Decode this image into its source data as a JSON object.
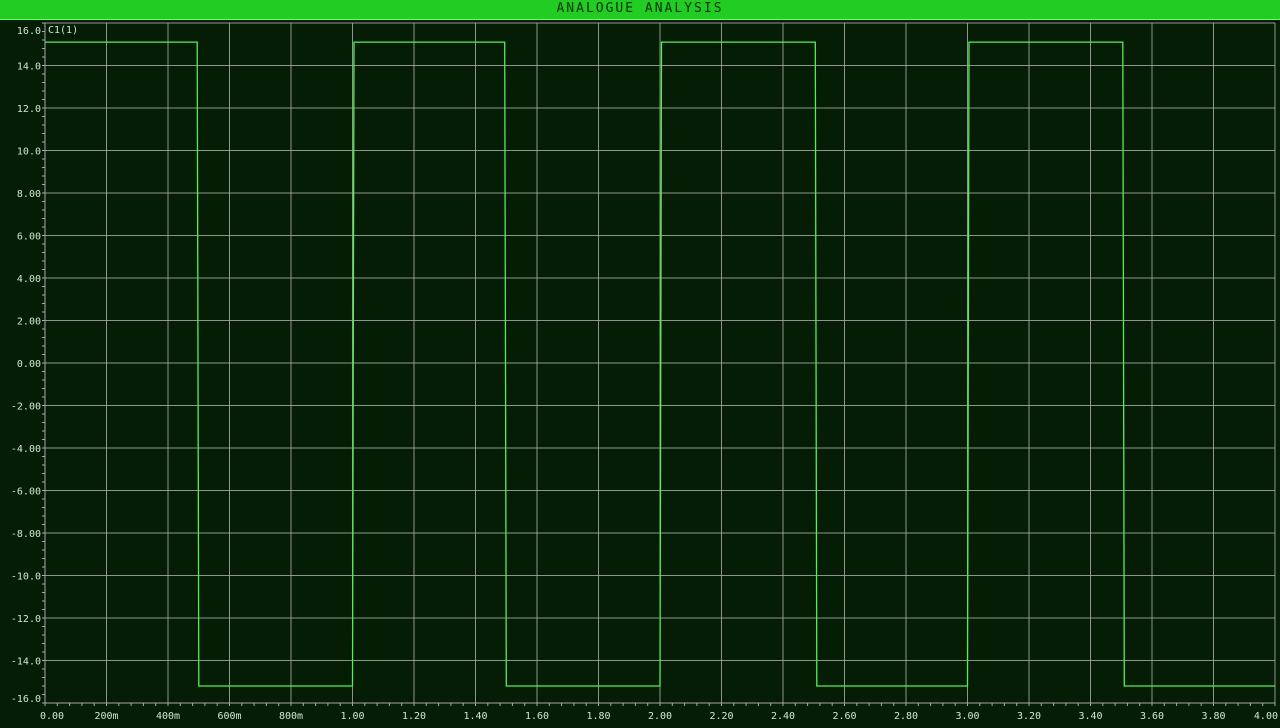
{
  "window": {
    "title": "ANALOGUE ANALYSIS"
  },
  "colors": {
    "background": "#041d04",
    "grid": "#a8a8a8",
    "trace": "#55ee55",
    "title_bar": "#22cc22",
    "tick_text": "#cfe8cf"
  },
  "chart_data": {
    "type": "line",
    "title": "ANALOGUE ANALYSIS",
    "xlabel": "",
    "ylabel": "",
    "xlim": [
      0,
      4.0
    ],
    "ylim": [
      -16.0,
      16.0
    ],
    "grid": true,
    "x_ticks": [
      0,
      0.2,
      0.4,
      0.6,
      0.8,
      1.0,
      1.2,
      1.4,
      1.6,
      1.8,
      2.0,
      2.2,
      2.4,
      2.6,
      2.8,
      3.0,
      3.2,
      3.4,
      3.6,
      3.8,
      4.0
    ],
    "x_tick_labels": [
      "0.00",
      "200m",
      "400m",
      "600m",
      "800m",
      "1.00",
      "1.20",
      "1.40",
      "1.60",
      "1.80",
      "2.00",
      "2.20",
      "2.40",
      "2.60",
      "2.80",
      "3.00",
      "3.20",
      "3.40",
      "3.60",
      "3.80",
      "4.00"
    ],
    "y_ticks": [
      16,
      14,
      12,
      10,
      8,
      6,
      4,
      2,
      0,
      -2,
      -4,
      -6,
      -8,
      -10,
      -12,
      -14,
      -16
    ],
    "y_tick_labels": [
      "16.0",
      "14.0",
      "12.0",
      "10.0",
      "8.00",
      "6.00",
      "4.00",
      "2.00",
      "0.00",
      "-2.00",
      "-4.00",
      "-6.00",
      "-8.00",
      "-10.0",
      "-12.0",
      "-14.0",
      "-16.0"
    ],
    "series": [
      {
        "name": "C1(1)",
        "x": [
          0,
          0.495,
          0.5,
          1.0,
          1.005,
          1.495,
          1.5,
          2.0,
          2.005,
          2.505,
          2.51,
          3.0,
          3.005,
          3.505,
          3.51,
          4.0
        ],
        "y": [
          15.1,
          15.1,
          -15.2,
          -15.2,
          15.1,
          15.1,
          -15.2,
          -15.2,
          15.1,
          15.1,
          -15.2,
          -15.2,
          15.1,
          15.1,
          -15.2,
          -15.2
        ]
      }
    ]
  }
}
